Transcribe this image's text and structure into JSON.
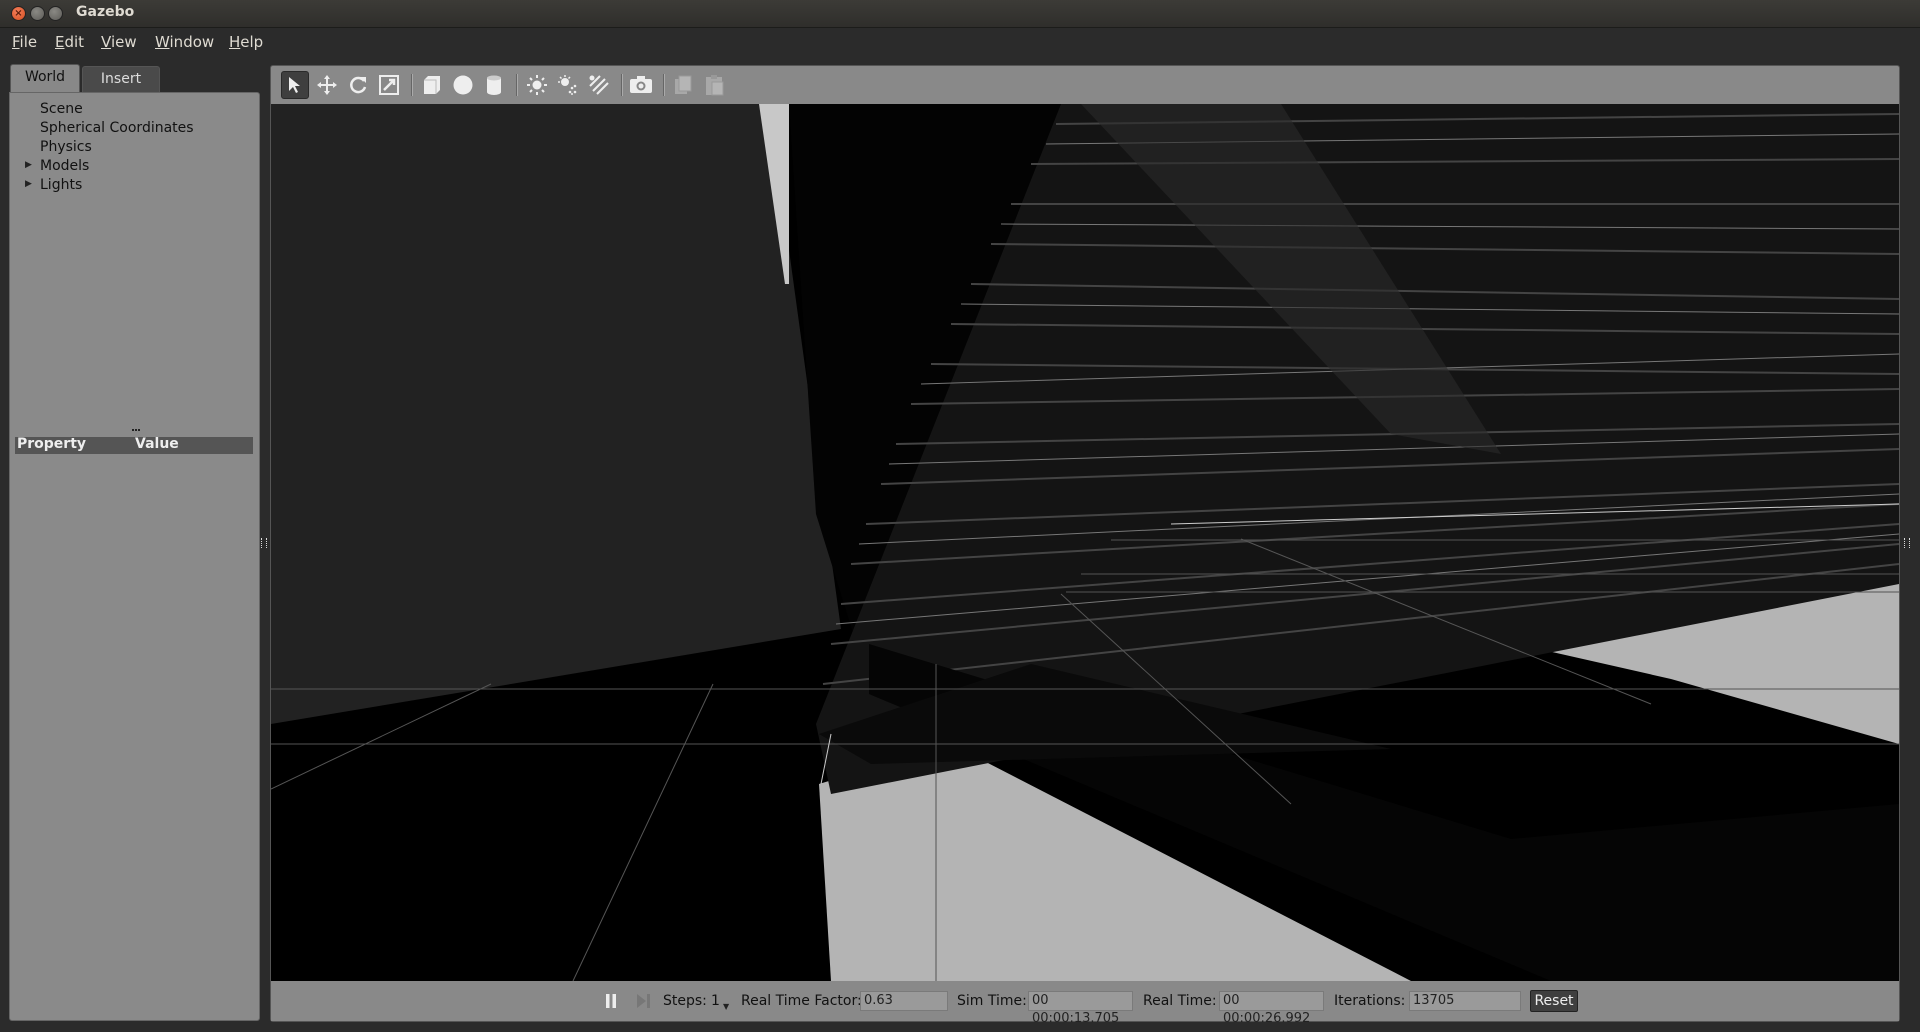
{
  "window": {
    "title": "Gazebo"
  },
  "menu": {
    "file": {
      "mnemonic": "F",
      "rest": "ile"
    },
    "edit": {
      "mnemonic": "E",
      "rest": "dit"
    },
    "view": {
      "mnemonic": "V",
      "rest": "iew"
    },
    "window": {
      "mnemonic": "W",
      "rest": "indow"
    },
    "help": {
      "mnemonic": "H",
      "rest": "elp"
    }
  },
  "left_panel": {
    "tabs": [
      {
        "label": "World"
      },
      {
        "label": "Insert"
      }
    ],
    "active_tab": "World",
    "tree": [
      {
        "label": "Scene"
      },
      {
        "label": "Spherical Coordinates"
      },
      {
        "label": "Physics"
      },
      {
        "label": "Models"
      },
      {
        "label": "Lights"
      }
    ],
    "property_header": {
      "property": "Property",
      "value": "Value"
    }
  },
  "toolbar": {
    "icons": [
      "select-arrow-icon",
      "translate-icon",
      "rotate-icon",
      "scale-icon",
      "box-icon",
      "sphere-icon",
      "cylinder-icon",
      "point-light-icon",
      "spot-light-icon",
      "directional-light-icon",
      "screenshot-icon",
      "copy-icon",
      "paste-icon"
    ]
  },
  "status": {
    "steps_label": "Steps:",
    "steps_value": "1",
    "rtf_label": "Real Time Factor:",
    "rtf_value": "0.63",
    "sim_time_label": "Sim Time:",
    "sim_time_value": "00 00:00:13.705",
    "real_time_label": "Real Time:",
    "real_time_value": "00 00:00:26.992",
    "iterations_label": "Iterations:",
    "iterations_value": "13705",
    "reset_label": "Reset"
  },
  "colors": {
    "background": "#2b2b2b",
    "panel": "#8a8a8a",
    "viewport": "#000000"
  }
}
